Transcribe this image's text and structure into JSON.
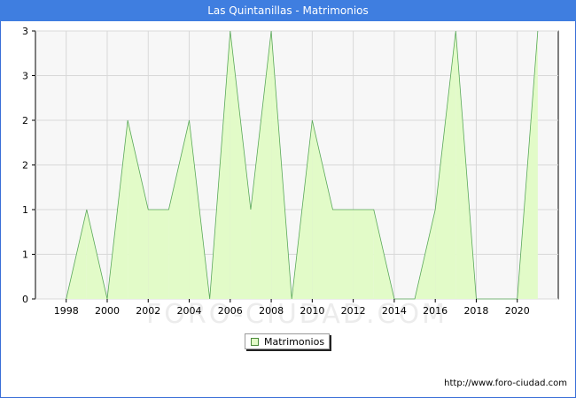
{
  "title": "Las Quintanillas - Matrimonios",
  "source_label": "http://www.foro-ciudad.com",
  "watermark": "FORO-CIUDAD.COM",
  "legend": {
    "label": "Matrimonios"
  },
  "colors": {
    "header_bg": "#3f7ee0",
    "fill": "#e2fbc8",
    "line": "#5aa85a",
    "grid": "#d8d8d8",
    "plot_bg": "#f7f7f7"
  },
  "chart_data": {
    "type": "area",
    "title": "Las Quintanillas - Matrimonios",
    "xlabel": "",
    "ylabel": "",
    "x_ticks": [
      "1998",
      "2000",
      "2002",
      "2004",
      "2006",
      "2008",
      "2010",
      "2012",
      "2014",
      "2016",
      "2018",
      "2020"
    ],
    "y_tick_labels": [
      "0",
      "1",
      "1",
      "2",
      "2",
      "3",
      "3"
    ],
    "xlim": [
      1996.5,
      2022
    ],
    "ylim": [
      0,
      3
    ],
    "grid": true,
    "legend_position": "bottom-center",
    "series": [
      {
        "name": "Matrimonios",
        "x": [
          1998,
          1999,
          2000,
          2001,
          2002,
          2003,
          2004,
          2005,
          2006,
          2007,
          2008,
          2009,
          2010,
          2011,
          2012,
          2013,
          2014,
          2015,
          2016,
          2017,
          2018,
          2019,
          2020,
          2021
        ],
        "values": [
          0,
          1,
          0,
          2,
          1,
          1,
          2,
          0,
          3,
          1,
          3,
          0,
          2,
          1,
          1,
          1,
          0,
          0,
          1,
          3,
          0,
          0,
          0,
          3
        ]
      }
    ]
  }
}
